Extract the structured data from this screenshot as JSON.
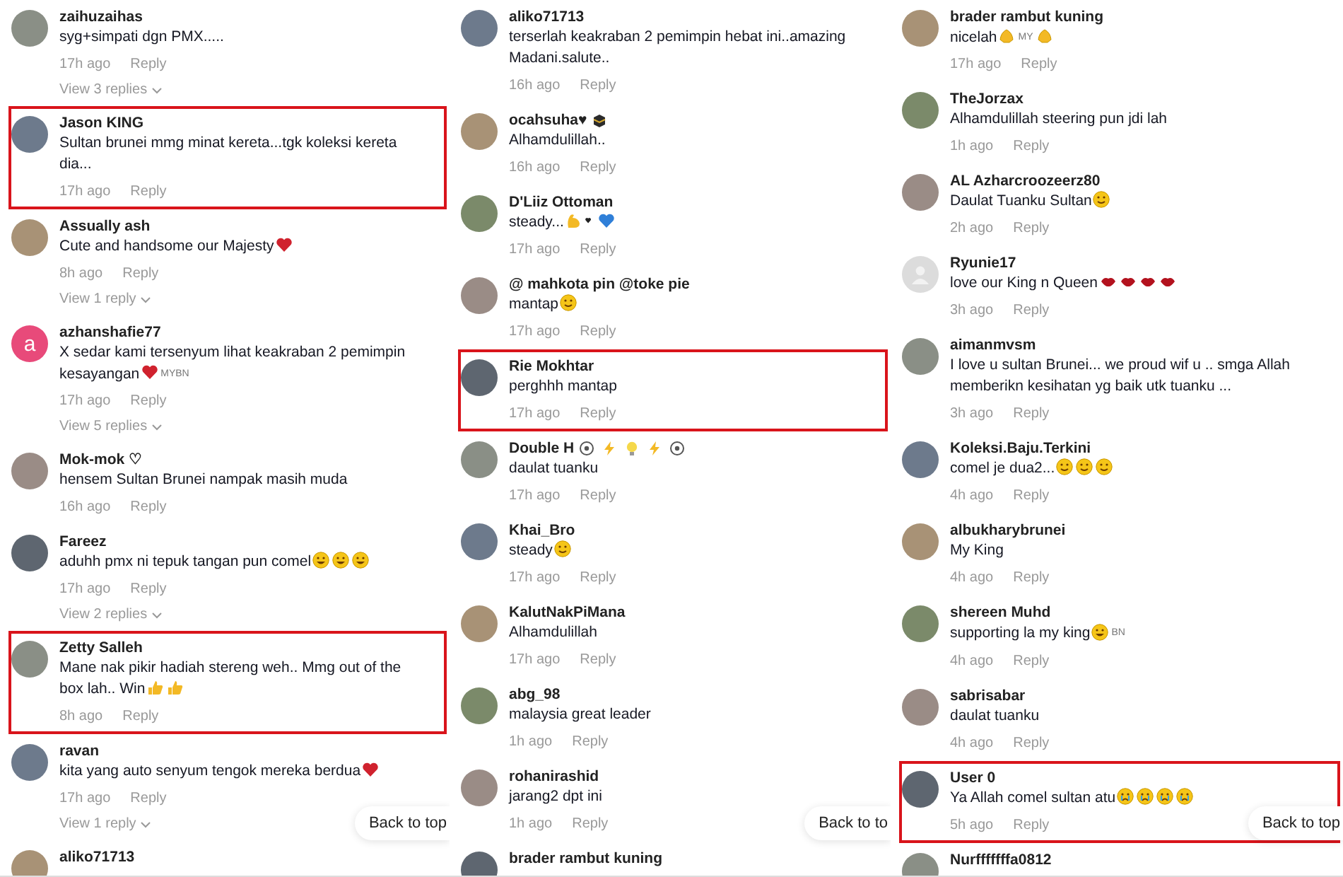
{
  "columns": [
    {
      "back_to_top": "Back to top",
      "comments": [
        {
          "avatar": {
            "kind": "photo"
          },
          "name": "zaihuzaihas",
          "text": "syg+simpati dgn PMX.....",
          "time": "17h ago",
          "reply": "Reply",
          "view_replies": "View 3 replies",
          "highlighted": false
        },
        {
          "avatar": {
            "kind": "photo"
          },
          "name": "Jason KING",
          "text": [
            "Sultan brunei mmg minat kereta...tgk koleksi kereta",
            "dia..."
          ],
          "time": "17h ago",
          "reply": "Reply",
          "highlighted": true
        },
        {
          "avatar": {
            "kind": "photo"
          },
          "name": "Assually ash",
          "text": "Cute and handsome our Majesty",
          "text_icons": [
            {
              "kind": "heart"
            }
          ],
          "time": "8h ago",
          "reply": "Reply",
          "view_replies": "View 1 reply",
          "highlighted": false
        },
        {
          "avatar": {
            "kind": "letter",
            "letter": "a"
          },
          "name": "azhanshafie77",
          "text": [
            "X sedar kami tersenyum lihat keakraban 2 pemimpin",
            "kesayangan"
          ],
          "text_icons": [
            {
              "kind": "heart"
            },
            {
              "kind": "tag",
              "text": "MYBN"
            }
          ],
          "time": "17h ago",
          "reply": "Reply",
          "view_replies": "View 5 replies",
          "highlighted": false
        },
        {
          "avatar": {
            "kind": "photo"
          },
          "name": "Mok-mok ♡",
          "text": "hensem Sultan Brunei nampak masih muda",
          "time": "16h ago",
          "reply": "Reply",
          "highlighted": false
        },
        {
          "avatar": {
            "kind": "photo"
          },
          "name": "Fareez",
          "text": "aduhh pmx ni tepuk tangan pun comel",
          "text_icons": [
            {
              "kind": "face-grin"
            },
            {
              "kind": "face-grin"
            },
            {
              "kind": "face-grin"
            }
          ],
          "time": "17h ago",
          "reply": "Reply",
          "view_replies": "View 2 replies",
          "highlighted": false
        },
        {
          "avatar": {
            "kind": "photo"
          },
          "name": "Zetty Salleh",
          "text": [
            "Mane nak pikir hadiah stereng weh.. Mmg out of the",
            "box lah.. Win"
          ],
          "text_icons": [
            {
              "kind": "thumb"
            },
            {
              "kind": "thumb"
            }
          ],
          "time": "8h ago",
          "reply": "Reply",
          "highlighted": true
        },
        {
          "avatar": {
            "kind": "photo"
          },
          "name": "ravan",
          "text": "kita yang auto senyum tengok mereka berdua",
          "text_icons": [
            {
              "kind": "heart"
            }
          ],
          "time": "17h ago",
          "reply": "Reply",
          "view_replies": "View 1 reply",
          "highlighted": false
        },
        {
          "avatar": {
            "kind": "photo"
          },
          "name": "aliko71713",
          "highlighted": false
        }
      ]
    },
    {
      "back_to_top": "Back to to",
      "comments": [
        {
          "avatar": {
            "kind": "photo"
          },
          "name": "aliko71713",
          "text": [
            "terserlah keakraban 2 pemimpin hebat ini..amazing",
            "Madani.salute.."
          ],
          "time": "16h ago",
          "reply": "Reply",
          "highlighted": false
        },
        {
          "avatar": {
            "kind": "photo"
          },
          "name": "ocahsuha♥",
          "name_icons": [
            {
              "kind": "cube"
            }
          ],
          "text": "Alhamdulillah..",
          "time": "16h ago",
          "reply": "Reply",
          "highlighted": false
        },
        {
          "avatar": {
            "kind": "photo"
          },
          "name": "D'Liiz Ottoman",
          "text": "steady...",
          "text_icons": [
            {
              "kind": "muscle"
            },
            {
              "kind": "heart-small"
            },
            {
              "kind": "heart-blue"
            }
          ],
          "time": "17h ago",
          "reply": "Reply",
          "highlighted": false
        },
        {
          "avatar": {
            "kind": "photo"
          },
          "name": "@ mahkota pin @toke pie",
          "text": "mantap",
          "text_icons": [
            {
              "kind": "face-smile"
            }
          ],
          "time": "17h ago",
          "reply": "Reply",
          "highlighted": false
        },
        {
          "avatar": {
            "kind": "photo"
          },
          "name": "Rie Mokhtar",
          "text": "perghhh mantap",
          "time": "17h ago",
          "reply": "Reply",
          "highlighted": true
        },
        {
          "avatar": {
            "kind": "photo"
          },
          "name": "Double H",
          "name_icons": [
            {
              "kind": "ring"
            },
            {
              "kind": "bolt"
            },
            {
              "kind": "bulb"
            },
            {
              "kind": "bolt"
            },
            {
              "kind": "ring"
            }
          ],
          "text": "daulat tuanku",
          "time": "17h ago",
          "reply": "Reply",
          "highlighted": false
        },
        {
          "avatar": {
            "kind": "photo"
          },
          "name": "Khai_Bro",
          "text": "steady",
          "text_icons": [
            {
              "kind": "face-smile"
            }
          ],
          "time": "17h ago",
          "reply": "Reply",
          "highlighted": false
        },
        {
          "avatar": {
            "kind": "photo"
          },
          "name": "KalutNakPiMana",
          "text": "Alhamdulillah",
          "time": "17h ago",
          "reply": "Reply",
          "highlighted": false
        },
        {
          "avatar": {
            "kind": "photo"
          },
          "name": "abg_98",
          "text": "malaysia great leader",
          "time": "1h ago",
          "reply": "Reply",
          "highlighted": false
        },
        {
          "avatar": {
            "kind": "photo"
          },
          "name": "rohanirashid",
          "text": "jarang2 dpt ini",
          "time": "1h ago",
          "reply": "Reply",
          "highlighted": false
        },
        {
          "avatar": {
            "kind": "photo"
          },
          "name": "brader rambut kuning",
          "highlighted": false
        }
      ]
    },
    {
      "back_to_top": "Back to top",
      "comments": [
        {
          "avatar": {
            "kind": "photo"
          },
          "name": "brader rambut kuning",
          "text": "nicelah",
          "text_icons": [
            {
              "kind": "pray"
            },
            {
              "kind": "tag",
              "text": "MY"
            },
            {
              "kind": "pray"
            }
          ],
          "time": "17h ago",
          "reply": "Reply",
          "highlighted": false
        },
        {
          "avatar": {
            "kind": "photo"
          },
          "name": "TheJorzax",
          "text": "Alhamdulillah steering pun jdi lah",
          "time": "1h ago",
          "reply": "Reply",
          "highlighted": false
        },
        {
          "avatar": {
            "kind": "photo"
          },
          "name": "AL Azharcroozeerz80",
          "text": "Daulat Tuanku Sultan",
          "text_icons": [
            {
              "kind": "face-smile"
            }
          ],
          "time": "2h ago",
          "reply": "Reply",
          "highlighted": false
        },
        {
          "avatar": {
            "kind": "default"
          },
          "name": "Ryunie17",
          "text": "love our King n Queen",
          "text_icons": [
            {
              "kind": "lips"
            },
            {
              "kind": "lips"
            },
            {
              "kind": "lips"
            },
            {
              "kind": "lips"
            }
          ],
          "time": "3h ago",
          "reply": "Reply",
          "highlighted": false
        },
        {
          "avatar": {
            "kind": "photo"
          },
          "name": "aimanmvsm",
          "text": [
            "I love u sultan Brunei... we proud wif u .. smga Allah",
            "memberikn kesihatan yg baik utk tuanku ..."
          ],
          "time": "3h ago",
          "reply": "Reply",
          "highlighted": false
        },
        {
          "avatar": {
            "kind": "photo"
          },
          "name": "Koleksi.Baju.Terkini",
          "text": "comel je dua2...",
          "text_icons": [
            {
              "kind": "face-smile"
            },
            {
              "kind": "face-smile"
            },
            {
              "kind": "face-smile"
            }
          ],
          "time": "4h ago",
          "reply": "Reply",
          "highlighted": false
        },
        {
          "avatar": {
            "kind": "photo"
          },
          "name": "albukharybrunei",
          "text": "My King",
          "time": "4h ago",
          "reply": "Reply",
          "highlighted": false
        },
        {
          "avatar": {
            "kind": "photo"
          },
          "name": "shereen Muhd",
          "text": "supporting la my king",
          "text_icons": [
            {
              "kind": "face-grin"
            },
            {
              "kind": "tag",
              "text": "BN"
            }
          ],
          "time": "4h ago",
          "reply": "Reply",
          "highlighted": false
        },
        {
          "avatar": {
            "kind": "photo"
          },
          "name": "sabrisabar",
          "text": "daulat tuanku",
          "time": "4h ago",
          "reply": "Reply",
          "highlighted": false
        },
        {
          "avatar": {
            "kind": "photo"
          },
          "name": "User 0",
          "text": "Ya Allah comel sultan atu",
          "text_icons": [
            {
              "kind": "face-cry"
            },
            {
              "kind": "face-cry"
            },
            {
              "kind": "face-cry"
            },
            {
              "kind": "face-cry"
            }
          ],
          "time": "5h ago",
          "reply": "Reply",
          "highlighted": true
        },
        {
          "avatar": {
            "kind": "photo"
          },
          "name": "Nurfffffffa0812",
          "highlighted": false
        }
      ]
    }
  ]
}
